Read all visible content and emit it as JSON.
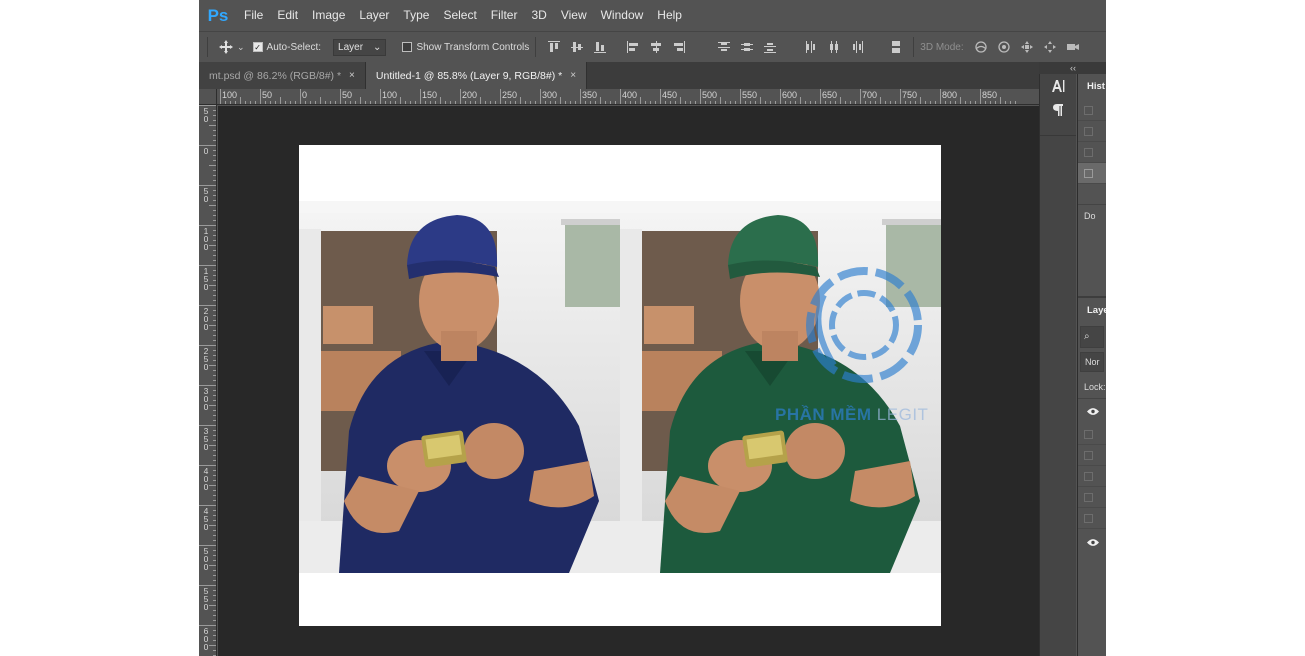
{
  "app": {
    "logo": "Ps"
  },
  "menu": [
    "File",
    "Edit",
    "Image",
    "Layer",
    "Type",
    "Select",
    "Filter",
    "3D",
    "View",
    "Window",
    "Help"
  ],
  "options": {
    "auto_select_label": "Auto-Select:",
    "auto_select_checked": true,
    "layer_dropdown": "Layer",
    "show_transform_label": "Show Transform Controls",
    "show_transform_checked": false,
    "mode_3d_label": "3D Mode:"
  },
  "tabs": [
    {
      "label": "mt.psd @ 86.2% (RGB/8#) *",
      "close": "×",
      "active": false
    },
    {
      "label": "Untitled-1 @ 85.8% (Layer 9, RGB/8#) *",
      "close": "×",
      "active": true
    }
  ],
  "ruler": {
    "h_labels": [
      "100",
      "50",
      "0",
      "50",
      "100",
      "150",
      "200",
      "250",
      "300",
      "350",
      "400",
      "450",
      "500",
      "550",
      "600",
      "650",
      "700",
      "750",
      "800",
      "850"
    ],
    "v_labels": [
      "50",
      "0",
      "50",
      "100",
      "150",
      "200",
      "250",
      "300",
      "350",
      "400",
      "450",
      "500",
      "550",
      "600"
    ]
  },
  "watermark": {
    "text_part1": "PHẦN MỀM",
    "text_part2": "LEGIT"
  },
  "panel": {
    "collapse_icon": "‹‹",
    "history_title": "Hist",
    "history_doc_label": "Do",
    "layers_title": "Laye",
    "layers_search": "⌕",
    "layers_blend": "Nor",
    "layers_lock_label": "Lock:"
  },
  "colors": {
    "shirt_left": "#1f2a63",
    "cap_left": "#2c3a86",
    "shirt_right": "#1d5a3d",
    "cap_right": "#2b6e4c",
    "skin": "#c98f6a",
    "accent": "#31a8ff",
    "watermark_blue": "#2d7fd0"
  }
}
